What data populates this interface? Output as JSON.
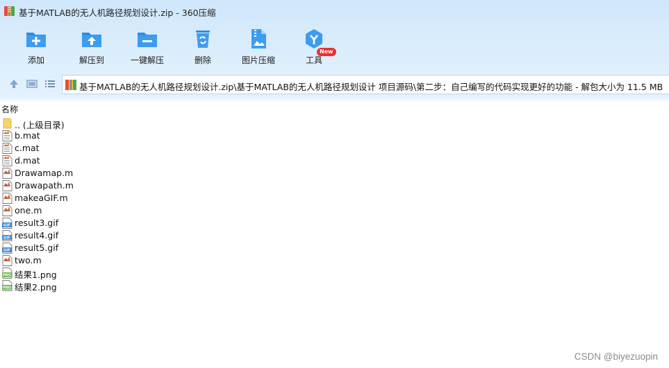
{
  "window": {
    "title": "基于MATLAB的无人机路径规划设计.zip - 360压缩"
  },
  "toolbar": {
    "buttons": [
      {
        "label": "添加",
        "icon": "add-icon"
      },
      {
        "label": "解压到",
        "icon": "extract-to-icon"
      },
      {
        "label": "一键解压",
        "icon": "one-click-extract-icon"
      },
      {
        "label": "删除",
        "icon": "delete-icon"
      },
      {
        "label": "图片压缩",
        "icon": "image-compress-icon"
      },
      {
        "label": "工具",
        "icon": "tools-icon"
      }
    ],
    "new_badge": "New"
  },
  "address": {
    "path": "基于MATLAB的无人机路径规划设计.zip\\基于MATLAB的无人机路径规划设计 项目源码\\第二步：自己编写的代码实现更好的功能 - 解包大小为 11.5 MB"
  },
  "list": {
    "column_name": "名称",
    "items": [
      {
        "name": ".. (上级目录)",
        "type": "folder"
      },
      {
        "name": "b.mat",
        "type": "mat"
      },
      {
        "name": "c.mat",
        "type": "mat"
      },
      {
        "name": "d.mat",
        "type": "mat"
      },
      {
        "name": "Drawamap.m",
        "type": "m"
      },
      {
        "name": "Drawapath.m",
        "type": "m"
      },
      {
        "name": "makeaGIF.m",
        "type": "m"
      },
      {
        "name": "one.m",
        "type": "m"
      },
      {
        "name": "result3.gif",
        "type": "gif"
      },
      {
        "name": "result4.gif",
        "type": "gif"
      },
      {
        "name": "result5.gif",
        "type": "gif"
      },
      {
        "name": "two.m",
        "type": "m"
      },
      {
        "name": "结果1.png",
        "type": "png"
      },
      {
        "name": "结果2.png",
        "type": "png"
      }
    ]
  },
  "watermark": "CSDN @biyezuopin",
  "colors": {
    "toolbar_icon_blue": "#2f8ee0",
    "badge_red": "#e8302f",
    "folder_yellow": "#f6d36b"
  }
}
